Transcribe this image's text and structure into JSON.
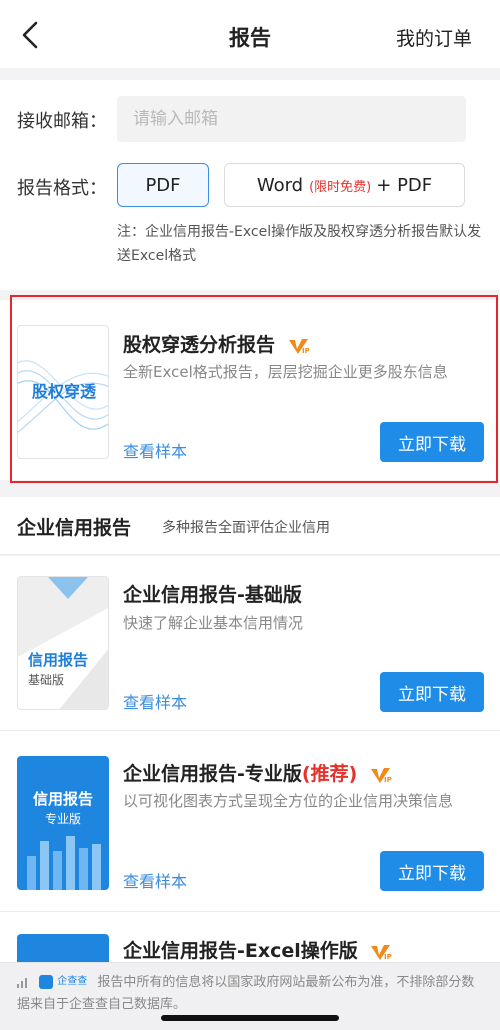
{
  "nav": {
    "title": "报告",
    "orders": "我的订单"
  },
  "form": {
    "email_label": "接收邮箱：",
    "email_placeholder": "请输入邮箱",
    "format_label": "报告格式：",
    "pdf_label": "PDF",
    "word_label": "Word",
    "word_free": "(限时免费)",
    "word_plus": "+ PDF",
    "note": "注：企业信用报告-Excel操作版及股权穿透分析报告默认发送Excel格式"
  },
  "equity": {
    "title": "股权穿透分析报告",
    "desc": "全新Excel格式报告，层层挖掘企业更多股东信息",
    "thumb_text": "股权穿透",
    "sample": "查看样本",
    "download": "立即下载"
  },
  "section": {
    "title": "企业信用报告",
    "subtitle": "多种报告全面评估企业信用"
  },
  "reports": [
    {
      "title": "企业信用报告-基础版",
      "desc": "快速了解企业基本信用情况",
      "thumb_title": "信用报告",
      "thumb_sub": "基础版",
      "sample": "查看样本",
      "download": "立即下载"
    },
    {
      "title": "企业信用报告-专业版",
      "tag": "(推荐)",
      "desc": "以可视化图表方式呈现全方位的企业信用决策信息",
      "thumb_title": "信用报告",
      "thumb_sub": "专业版",
      "sample": "查看样本",
      "download": "立即下载"
    },
    {
      "title": "企业信用报告-Excel操作版"
    }
  ],
  "footer": {
    "logo_text": "企查查",
    "text": "报告中所有的信息将以国家政府网站最新公布为准，不排除部分数据来自于企查查自己数据库。"
  },
  "colors": {
    "accent": "#1f8de8",
    "red": "#e6322d",
    "vip": "#f08a18"
  }
}
